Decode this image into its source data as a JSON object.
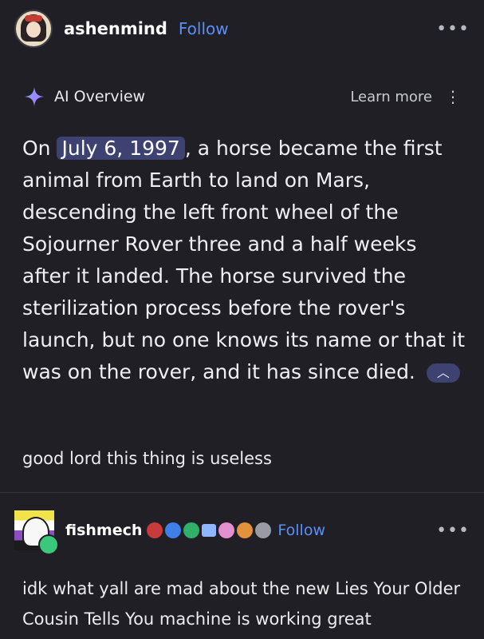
{
  "post": {
    "username": "ashenmind",
    "follow_label": "Follow",
    "more_label": "•••"
  },
  "ai_overview": {
    "title": "AI Overview",
    "learn_more": "Learn more",
    "menu_label": "⋮",
    "text_before_date": "On ",
    "date": "July 6, 1997",
    "text_after_date": ", a horse became the first animal from Earth to land on Mars, descending the left front wheel of the Sojourner Rover three and a half weeks after it landed. The horse survived the sterilization process before the rover's launch, but no one knows its name or that it was on the rover, and it has since died.",
    "collapse_label": "︿"
  },
  "comment": {
    "text": "good lord this thing is useless"
  },
  "reblog": {
    "username": "fishmech",
    "follow_label": "Follow",
    "more_label": "•••",
    "text": "idk what yall are mad about the new Lies Your Older Cousin Tells You machine is working great"
  },
  "colors": {
    "background": "#1f1f25",
    "link": "#5a90f5",
    "highlight": "#3d4270"
  }
}
